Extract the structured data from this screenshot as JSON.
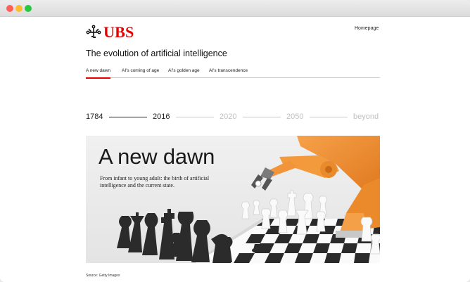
{
  "brand": {
    "name": "UBS",
    "color": "#e60000",
    "emblem": "keys-emblem-icon"
  },
  "header": {
    "homepage_link": "Homepage"
  },
  "page_title": "The evolution of artificial intelligence",
  "tabs": [
    {
      "label": "A new dawn",
      "active": true
    },
    {
      "label": "AI's coming of age",
      "active": false
    },
    {
      "label": "AI's golden age",
      "active": false
    },
    {
      "label": "AI's transcendence",
      "active": false
    }
  ],
  "timeline": {
    "years": [
      "1784",
      "2016",
      "2020",
      "2050",
      "beyond"
    ],
    "active_index": 1
  },
  "hero": {
    "title": "A new dawn",
    "subtitle": "From infant to young adult: the birth of artificial intelligence and the current state.",
    "image_description_icon": "robot-arm-chess-image"
  },
  "source_caption": "Source: Getty Images",
  "colors": {
    "accent": "#e60000",
    "robot": "#f08a2e",
    "inactive_timeline": "#c8c8c8"
  }
}
